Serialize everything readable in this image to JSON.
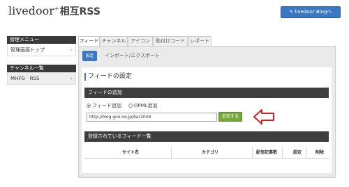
{
  "header": {
    "logo_main": "livedoor",
    "logo_sup": "+",
    "logo_suffix": "相互RSS",
    "blog_button": "livedoor Blogへ"
  },
  "sidebar": {
    "sections": [
      {
        "heading": "管理メニュー",
        "items": [
          {
            "label": "管理画面トップ"
          }
        ]
      },
      {
        "heading": "チャンネル一覧",
        "items": [
          {
            "label": "MHFG　RSS"
          }
        ]
      }
    ]
  },
  "tabs": [
    "フィード",
    "チャンネル",
    "アイコン",
    "貼付けコード",
    "レポート"
  ],
  "subnav": {
    "active": "設定",
    "link": "インポート/エクスポート"
  },
  "feed_settings": {
    "title": "フィードの設定",
    "add_bar": "フィードの追加",
    "radio_feed": "フィード追加",
    "radio_opml": "OPML追加",
    "url_value": "http://blog.goo.ne.jp/bar2049",
    "add_button": "追加する",
    "list_bar": "登録されているフィード一覧",
    "columns": [
      "サイト名",
      "カテゴリ",
      "配信記事数",
      "設定",
      "削除"
    ]
  },
  "colors": {
    "accent": "#3b78c4",
    "add_button": "#78a83a",
    "bar": "#3e3e3e",
    "annotation": "#d11f1f"
  }
}
